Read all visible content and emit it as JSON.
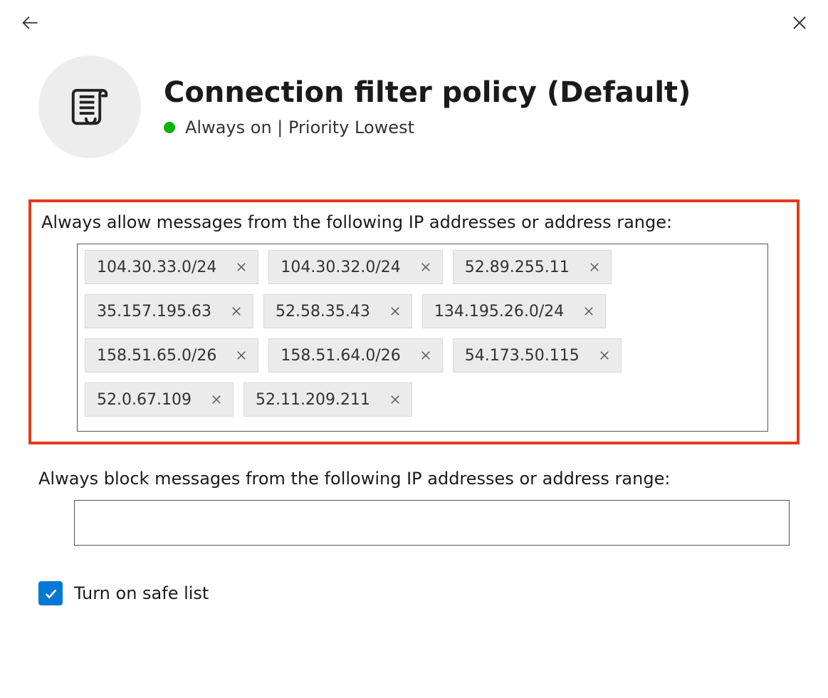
{
  "header": {
    "title": "Connection filter policy (Default)",
    "status_text": "Always on | Priority Lowest"
  },
  "allow": {
    "label": "Always allow messages from the following IP addresses or address range:",
    "chips": [
      "104.30.33.0/24",
      "104.30.32.0/24",
      "52.89.255.11",
      "35.157.195.63",
      "52.58.35.43",
      "134.195.26.0/24",
      "158.51.65.0/26",
      "158.51.64.0/26",
      "54.173.50.115",
      "52.0.67.109",
      "52.11.209.211"
    ]
  },
  "block": {
    "label": "Always block messages from the following IP addresses or address range:"
  },
  "safe_list": {
    "label": "Turn on safe list",
    "checked": true
  }
}
